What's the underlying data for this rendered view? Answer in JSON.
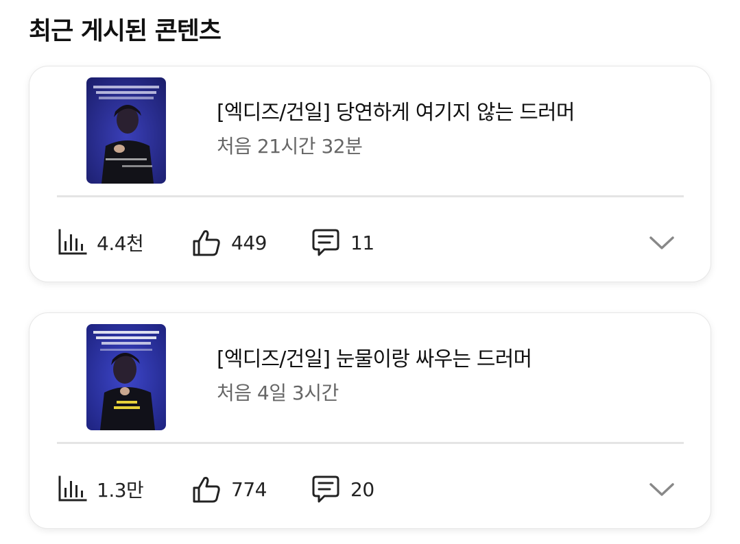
{
  "section": {
    "title": "최근 게시된 콘텐츠"
  },
  "posts": [
    {
      "title": "[엑디즈/건일] 당연하게 여기지 않는 드러머",
      "age": "처음 21시간 32분",
      "views": "4.4천",
      "likes": "449",
      "comments": "11"
    },
    {
      "title": "[엑디즈/건일] 눈물이랑 싸우는 드러머",
      "age": "처음 4일 3시간",
      "views": "1.3만",
      "likes": "774",
      "comments": "20"
    }
  ],
  "icons": {
    "views": "bar-chart-icon",
    "likes": "thumbs-up-icon",
    "comments": "comment-icon",
    "expand": "chevron-down-icon"
  },
  "colors": {
    "text": "#111111",
    "secondary_text": "#666666",
    "divider": "#e4e4e4",
    "chevron": "#888888"
  }
}
